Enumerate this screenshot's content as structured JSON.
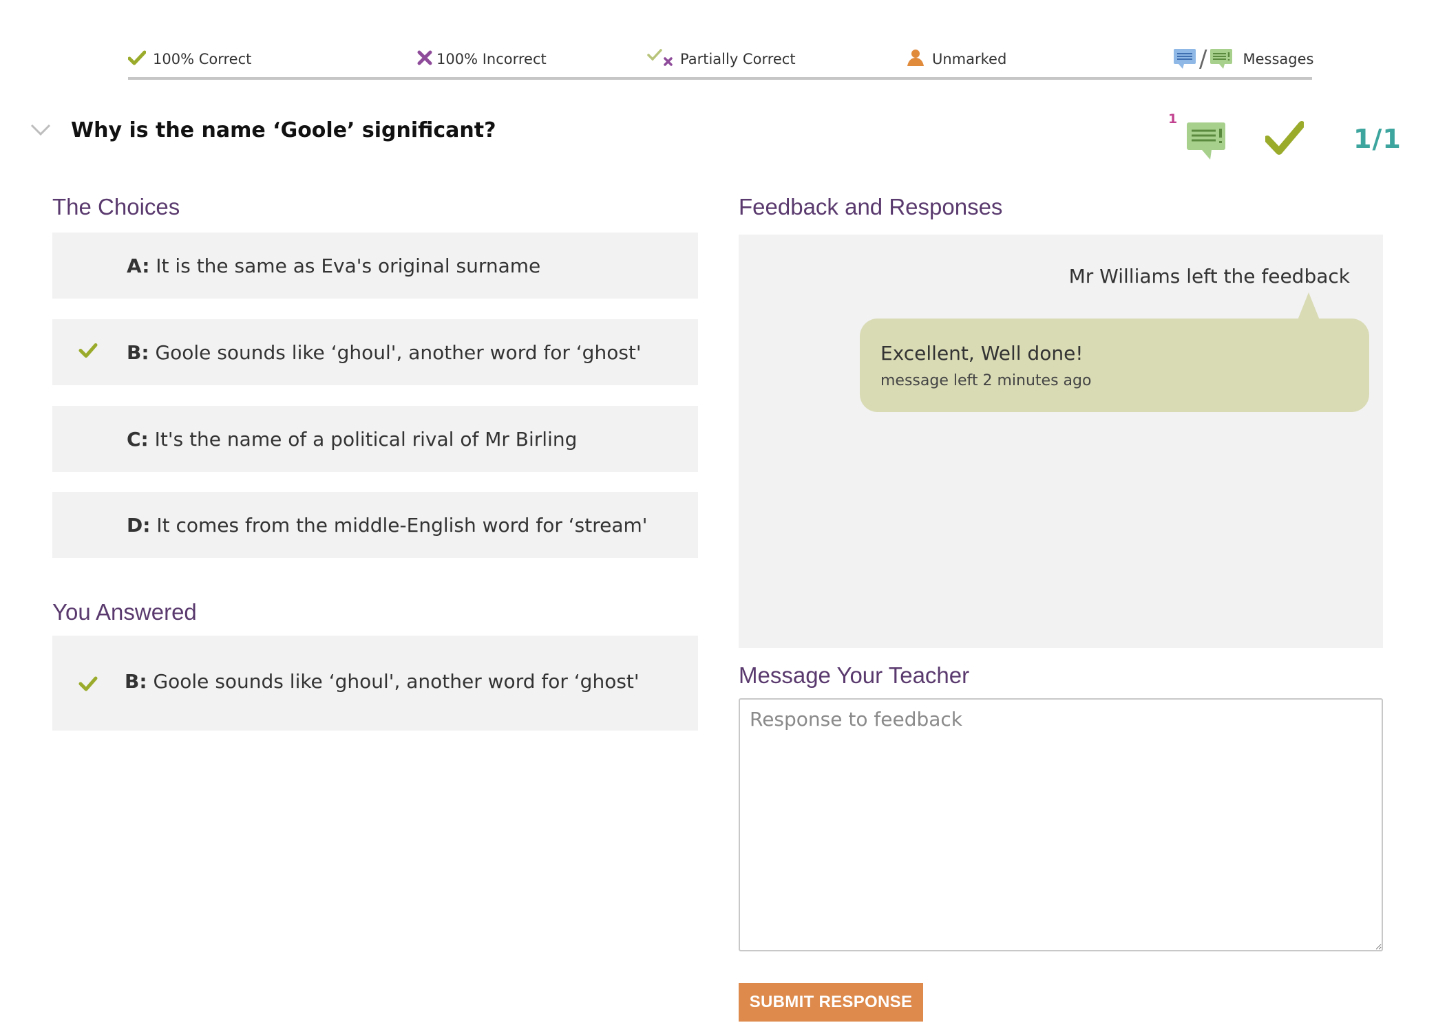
{
  "legend": {
    "correct": "100% Correct",
    "incorrect": "100% Incorrect",
    "partial": "Partially Correct",
    "unmarked": "Unmarked",
    "messages": "Messages"
  },
  "question": {
    "title": "Why is the name ‘Goole’ significant?",
    "message_count": "1",
    "score": "1/1"
  },
  "choices": {
    "heading": "The Choices",
    "items": [
      {
        "letter": "A:",
        "text": " It is the same as Eva's original surname",
        "correct": false
      },
      {
        "letter": "B:",
        "text": " Goole sounds like ‘ghoul', another word for ‘ghost'",
        "correct": true
      },
      {
        "letter": "C:",
        "text": " It's the name of a political rival of Mr Birling",
        "correct": false
      },
      {
        "letter": "D:",
        "text": " It comes from the middle-English word for ‘stream'",
        "correct": false
      }
    ]
  },
  "answered": {
    "heading": "You Answered",
    "letter": "B:",
    "text": " Goole sounds like ‘ghoul', another word for ‘ghost'"
  },
  "feedback": {
    "heading": "Feedback and Responses",
    "author": "Mr Williams left the feedback",
    "message": "Excellent, Well done!",
    "time": "message left 2 minutes ago"
  },
  "teacher_message": {
    "heading": "Message Your Teacher",
    "placeholder": "Response to feedback",
    "submit_label": "SUBMIT RESPONSE"
  },
  "colors": {
    "heading_purple": "#5a3a6e",
    "correct_green": "#9aab2b",
    "incorrect_purple": "#8e4b9a",
    "unmarked_orange": "#e08a3c",
    "score_teal": "#3da59e",
    "button_orange": "#dd8a4c",
    "bubble_green": "#d9dbb5"
  },
  "icons": [
    "check-icon",
    "cross-icon",
    "partial-icon",
    "unmarked-icon",
    "message-icon",
    "chevron-down-icon"
  ]
}
